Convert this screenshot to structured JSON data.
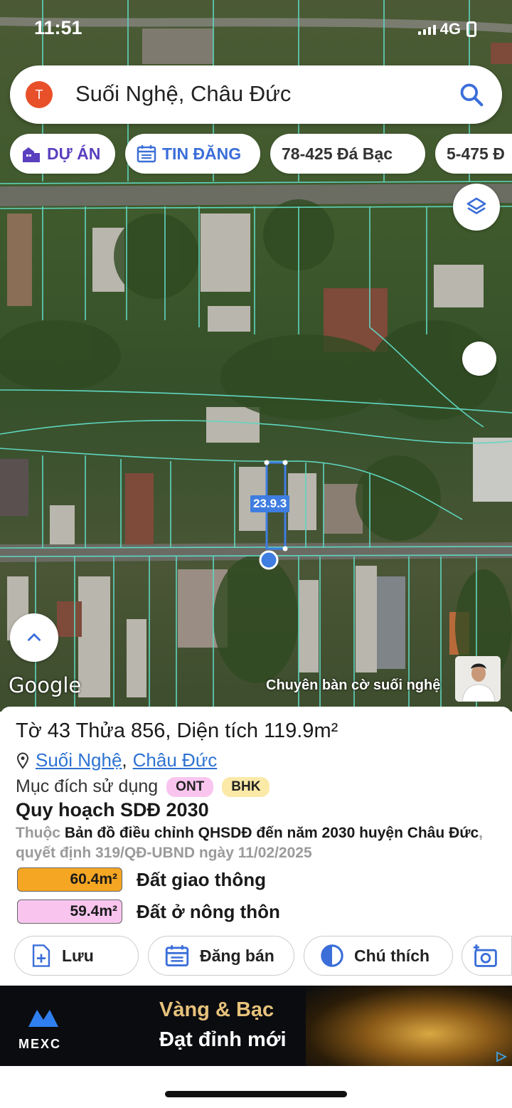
{
  "status": {
    "time": "11:51",
    "network": "4G"
  },
  "search": {
    "avatar_letter": "T",
    "query": "Suối Nghệ, Châu Đức"
  },
  "chips": [
    {
      "label": "DỰ ÁN",
      "icon": "building-icon"
    },
    {
      "label": "TIN ĐĂNG",
      "icon": "calendar-icon"
    },
    {
      "label": "78-425 Đá Bạc"
    },
    {
      "label": "5-475 Đ"
    }
  ],
  "map": {
    "measurement_label": "23.9.3",
    "google_label": "Google",
    "credit": "Chuyên bàn cờ suối nghệ"
  },
  "parcel": {
    "title": "Tờ 43 Thửa 856, Diện tích 119.9m²",
    "ward": "Suối Nghệ",
    "separator": ",",
    "district": "Châu Đức",
    "usage_label": "Mục đích sử dụng",
    "usage_tags": [
      "ONT",
      "BHK"
    ],
    "plan_title": "Quy hoạch SDĐ 2030",
    "plan_prefix": "Thuộc",
    "plan_map": "Bản đồ điều chỉnh QHSDĐ đến năm 2030 huyện Châu Đức",
    "plan_decision": ", quyết định 319/QĐ-UBND ngày 11/02/2025",
    "areas": [
      {
        "value": "60.4m²",
        "label": "Đất giao thông",
        "color": "#f5a623"
      },
      {
        "value": "59.4m²",
        "label": "Đất ở nông thôn",
        "color": "#f9c5ef"
      }
    ]
  },
  "actions": [
    {
      "label": "Lưu",
      "icon": "save-add-icon"
    },
    {
      "label": "Đăng bán",
      "icon": "listing-icon"
    },
    {
      "label": "Chú thích",
      "icon": "legend-icon"
    },
    {
      "label": "",
      "icon": "add-photo-icon"
    }
  ],
  "ad": {
    "line1": "Vàng & Bạc",
    "line2": "Đạt đỉnh mới",
    "brand": "MEXC"
  },
  "colors": {
    "accent": "#2e72d2",
    "parcel_lines": "#5fd6c0"
  }
}
